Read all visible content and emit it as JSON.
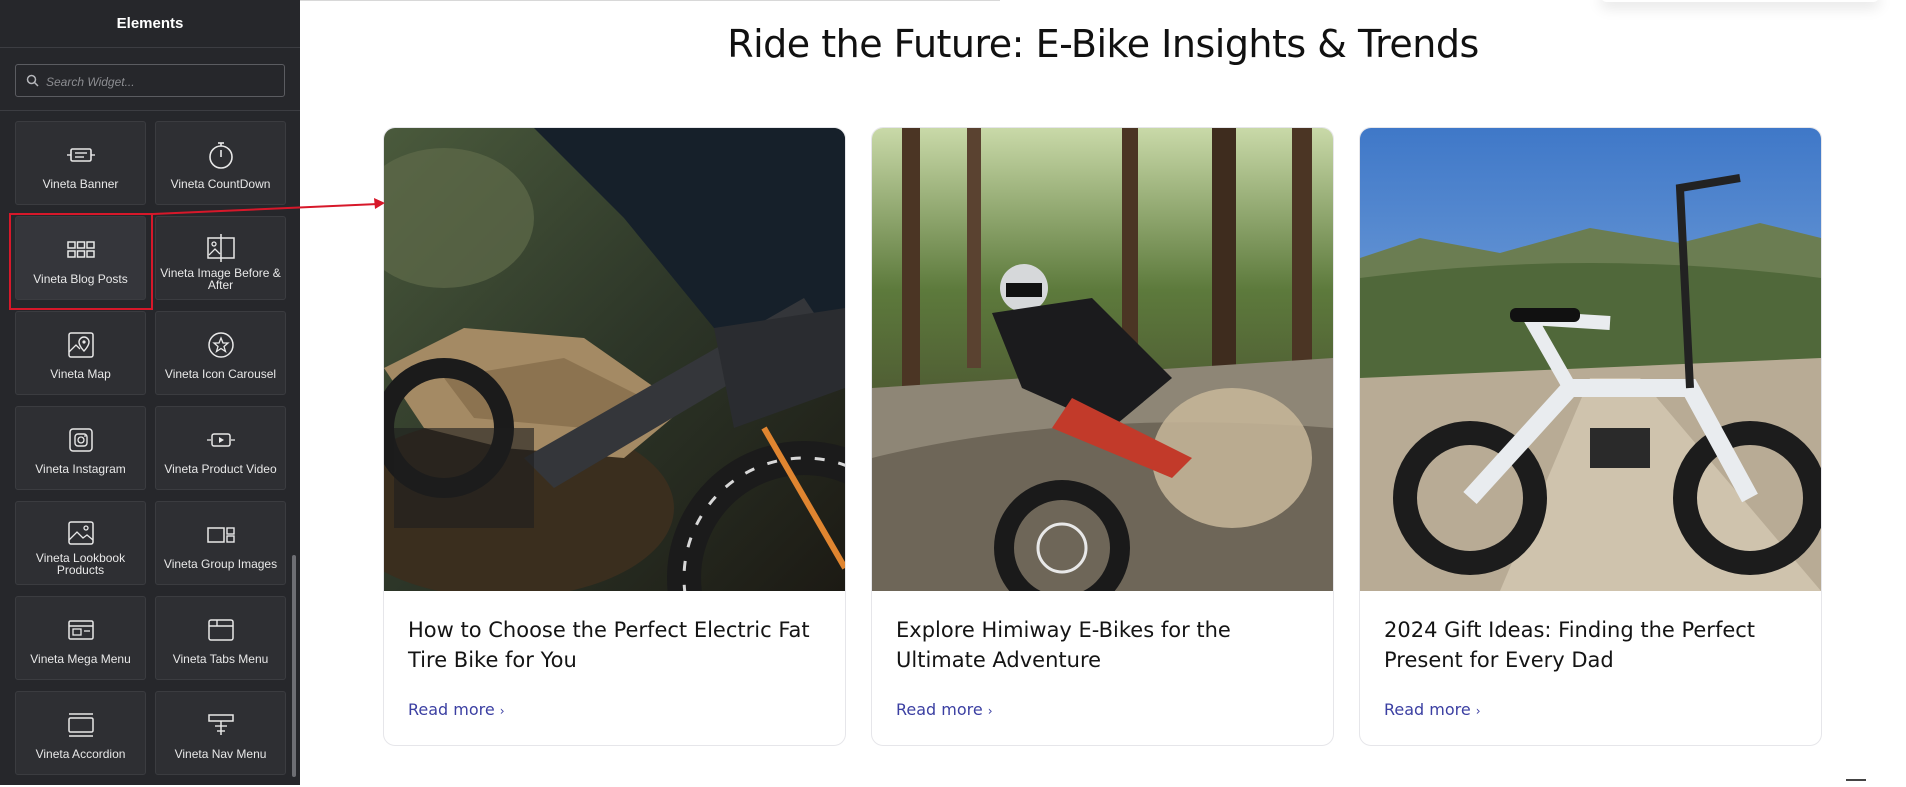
{
  "sidebar": {
    "title": "Elements",
    "search_placeholder": "Search Widget...",
    "widgets": [
      {
        "label": "Vineta Banner",
        "icon": "banner-icon"
      },
      {
        "label": "Vineta CountDown",
        "icon": "stopwatch-icon"
      },
      {
        "label": "Vineta Blog Posts",
        "icon": "grid-icon",
        "selected": true
      },
      {
        "label": "Vineta Image Before & After",
        "icon": "image-compare-icon"
      },
      {
        "label": "Vineta Map",
        "icon": "map-pin-icon"
      },
      {
        "label": "Vineta Icon Carousel",
        "icon": "star-circle-icon"
      },
      {
        "label": "Vineta Instagram",
        "icon": "instagram-icon"
      },
      {
        "label": "Vineta Product Video",
        "icon": "video-play-icon"
      },
      {
        "label": "Vineta Lookbook Products",
        "icon": "lookbook-image-icon"
      },
      {
        "label": "Vineta Group Images",
        "icon": "group-images-icon"
      },
      {
        "label": "Vineta Mega Menu",
        "icon": "mega-menu-icon"
      },
      {
        "label": "Vineta Tabs Menu",
        "icon": "tabs-icon"
      },
      {
        "label": "Vineta Accordion",
        "icon": "accordion-icon"
      },
      {
        "label": "Vineta Nav Menu",
        "icon": "nav-menu-icon"
      }
    ]
  },
  "main": {
    "heading": "Ride the Future: E-Bike Insights & Trends",
    "posts": [
      {
        "title": "How to Choose the Perfect Electric Fat Tire Bike for You",
        "read_more": "Read more",
        "image": "rider-on-fat-tire-ebike-photo"
      },
      {
        "title": "Explore Himiway E-Bikes for the Ultimate Adventure",
        "read_more": "Read more",
        "image": "mountain-biker-in-forest-photo"
      },
      {
        "title": "2024 Gift Ideas: Finding the Perfect Present for Every Dad",
        "read_more": "Read more",
        "image": "white-folding-ebike-photo"
      }
    ]
  },
  "colors": {
    "sidebar_bg": "#26272b",
    "highlight": "#d7182a",
    "link": "#3b3fa2",
    "heading": "#111111"
  }
}
